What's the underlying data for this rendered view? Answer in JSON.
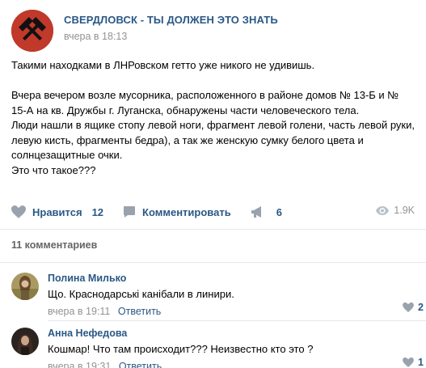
{
  "post": {
    "author": "СВЕРДЛОВСК - ТЫ ДОЛЖЕН ЭТО ЗНАТЬ",
    "time": "вчера в 18:13",
    "paragraphs": [
      "Такими находками в ЛНРовском гетто уже никого не удивишь.",
      "",
      "Вчера вечером возле мусорника, расположенного в районе домов № 13-Б и № 15-А на кв. Дружбы г. Луганска, обнаружены части человеческого тела.",
      "Люди нашли в ящике стопу левой ноги, фрагмент левой голени, часть левой руки, левую кисть, фрагменты бедра), а так же женскую сумку белого цвета и солнцезащитные очки.",
      "Это что такое???"
    ],
    "actions": {
      "like_label": "Нравится",
      "like_count": "12",
      "comment_label": "Комментировать",
      "share_count": "6",
      "views": "1.9K"
    }
  },
  "comments_header": "11 комментариев",
  "comments": [
    {
      "author": "Полина Милько",
      "text": "Що. Краснодарські канібали в линири.",
      "time": "вчера в 19:11",
      "reply": "Ответить",
      "likes": "2"
    },
    {
      "author": "Анна Нефедова",
      "text": "Кошмар! Что там происходит??? Неизвестно кто это ?",
      "time": "вчера в 19:31",
      "reply": "Ответить",
      "likes": "1"
    }
  ],
  "colors": {
    "link": "#2a5885",
    "muted": "#939393",
    "icon": "#99a2ad",
    "avatar_bg": "#c0392b"
  },
  "icons": {
    "group_avatar": "crossed-hammers-icon",
    "like": "heart-icon",
    "comment": "comment-bubble-icon",
    "share": "megaphone-icon",
    "views": "eye-icon"
  }
}
